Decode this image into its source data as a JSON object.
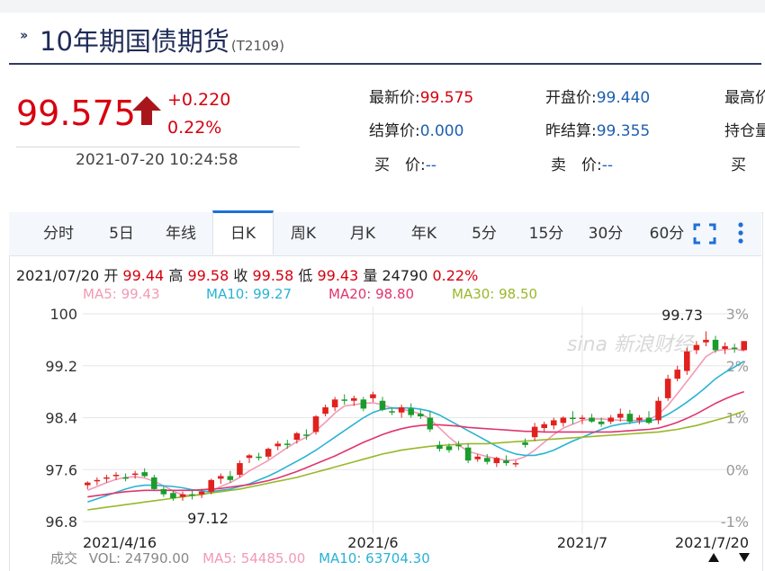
{
  "header": {
    "title": "10年期国债期货",
    "code": "(T2109)"
  },
  "quote": {
    "price": "99.575",
    "change": "+0.220",
    "change_pct": "0.22%",
    "datetime": "2021-07-20 10:24:58"
  },
  "fields": {
    "latest_label": "最新价:",
    "latest_value": "99.575",
    "open_label": "开盘价:",
    "open_value": "99.440",
    "high_label": "最高价",
    "settle_label": "结算价:",
    "settle_value": "0.000",
    "prev_settle_label": "昨结算:",
    "prev_settle_value": "99.355",
    "position_label": "持仓量",
    "buy_label": "买　价:",
    "buy_value": "--",
    "sell_label": "卖　价:",
    "sell_value": "--",
    "buy_vol_label": "买"
  },
  "tabs": [
    {
      "label": "分时"
    },
    {
      "label": "5日"
    },
    {
      "label": "年线"
    },
    {
      "label": "日K"
    },
    {
      "label": "周K"
    },
    {
      "label": "月K"
    },
    {
      "label": "年K"
    },
    {
      "label": "5分"
    },
    {
      "label": "15分"
    },
    {
      "label": "30分"
    },
    {
      "label": "60分"
    }
  ],
  "active_tab": "日K",
  "info": {
    "date": "2021/07/20",
    "open_label": "开",
    "open": "99.44",
    "high_label": "高",
    "high": "99.58",
    "close_label": "收",
    "close": "99.58",
    "low_label": "低",
    "low": "99.43",
    "vol_label": "量",
    "vol": "24790",
    "pct": "0.22%"
  },
  "ma": {
    "ma5": "MA5: 99.43",
    "ma10": "MA10: 99.27",
    "ma20": "MA20: 98.80",
    "ma30": "MA30: 98.50"
  },
  "volume": {
    "label": "成交",
    "vol": "VOL: 24790.00",
    "ma5": "MA5: 54485.00",
    "ma10": "MA10: 63704.30"
  },
  "colors": {
    "up": "#e0211d",
    "down": "#1a9c2c",
    "ma5": "#f29ab4",
    "ma10": "#2ab3d3",
    "ma20": "#e0356e",
    "ma30": "#98b82a",
    "accent": "#1d6fd8"
  },
  "chart_data": {
    "type": "candlestick",
    "y_ticks_left": [
      "100",
      "99.2",
      "98.4",
      "97.6",
      "96.8"
    ],
    "y_ticks_right": [
      "3%",
      "2%",
      "1%",
      "0%",
      "-1%"
    ],
    "ylim": [
      96.8,
      100
    ],
    "x_labels": [
      "2021/4/16",
      "2021/6",
      "2021/7",
      "2021/7/20"
    ],
    "annotations": {
      "max": "99.73",
      "min": "97.12"
    },
    "watermark": "新浪财经",
    "candles": [
      [
        97.36,
        97.42,
        97.3,
        97.4
      ],
      [
        97.42,
        97.48,
        97.36,
        97.44
      ],
      [
        97.46,
        97.52,
        97.4,
        97.48
      ],
      [
        97.5,
        97.56,
        97.44,
        97.52
      ],
      [
        97.48,
        97.54,
        97.42,
        97.46
      ],
      [
        97.52,
        97.58,
        97.46,
        97.54
      ],
      [
        97.56,
        97.62,
        97.48,
        97.5
      ],
      [
        97.48,
        97.52,
        97.28,
        97.3
      ],
      [
        97.3,
        97.34,
        97.18,
        97.22
      ],
      [
        97.24,
        97.28,
        97.12,
        97.16
      ],
      [
        97.18,
        97.26,
        97.12,
        97.22
      ],
      [
        97.22,
        97.28,
        97.14,
        97.2
      ],
      [
        97.22,
        97.3,
        97.16,
        97.26
      ],
      [
        97.26,
        97.46,
        97.22,
        97.44
      ],
      [
        97.46,
        97.54,
        97.38,
        97.5
      ],
      [
        97.5,
        97.58,
        97.4,
        97.44
      ],
      [
        97.52,
        97.74,
        97.48,
        97.7
      ],
      [
        97.78,
        97.84,
        97.7,
        97.82
      ],
      [
        97.8,
        97.86,
        97.74,
        97.78
      ],
      [
        97.8,
        97.94,
        97.76,
        97.92
      ],
      [
        97.96,
        98.04,
        97.9,
        98.0
      ],
      [
        98.0,
        98.06,
        97.92,
        97.98
      ],
      [
        98.06,
        98.18,
        98.0,
        98.16
      ],
      [
        98.14,
        98.22,
        98.06,
        98.12
      ],
      [
        98.18,
        98.44,
        98.14,
        98.42
      ],
      [
        98.46,
        98.6,
        98.42,
        98.56
      ],
      [
        98.56,
        98.72,
        98.5,
        98.68
      ],
      [
        98.68,
        98.76,
        98.6,
        98.66
      ],
      [
        98.66,
        98.74,
        98.58,
        98.7
      ],
      [
        98.68,
        98.72,
        98.5,
        98.54
      ],
      [
        98.7,
        98.8,
        98.64,
        98.76
      ],
      [
        98.66,
        98.72,
        98.5,
        98.52
      ],
      [
        98.5,
        98.56,
        98.44,
        98.48
      ],
      [
        98.48,
        98.6,
        98.4,
        98.56
      ],
      [
        98.54,
        98.62,
        98.4,
        98.44
      ],
      [
        98.46,
        98.52,
        98.38,
        98.42
      ],
      [
        98.4,
        98.5,
        98.18,
        98.22
      ],
      [
        97.98,
        98.04,
        97.88,
        97.92
      ],
      [
        97.96,
        98.0,
        97.86,
        97.9
      ],
      [
        97.98,
        98.04,
        97.9,
        97.96
      ],
      [
        97.94,
        98.0,
        97.7,
        97.74
      ],
      [
        97.76,
        97.84,
        97.72,
        97.8
      ],
      [
        97.78,
        97.84,
        97.68,
        97.72
      ],
      [
        97.7,
        97.8,
        97.64,
        97.78
      ],
      [
        97.74,
        97.82,
        97.66,
        97.7
      ],
      [
        97.68,
        97.74,
        97.64,
        97.7
      ],
      [
        98.02,
        98.08,
        97.94,
        97.98
      ],
      [
        98.1,
        98.32,
        98.04,
        98.26
      ],
      [
        98.24,
        98.34,
        98.18,
        98.3
      ],
      [
        98.28,
        98.4,
        98.22,
        98.36
      ],
      [
        98.32,
        98.42,
        98.26,
        98.4
      ],
      [
        98.4,
        98.5,
        98.3,
        98.38
      ],
      [
        98.38,
        98.44,
        98.3,
        98.4
      ],
      [
        98.4,
        98.46,
        98.32,
        98.34
      ],
      [
        98.34,
        98.4,
        98.26,
        98.3
      ],
      [
        98.34,
        98.44,
        98.3,
        98.4
      ],
      [
        98.4,
        98.54,
        98.34,
        98.46
      ],
      [
        98.46,
        98.52,
        98.3,
        98.34
      ],
      [
        98.36,
        98.44,
        98.3,
        98.4
      ],
      [
        98.4,
        98.5,
        98.3,
        98.32
      ],
      [
        98.36,
        98.72,
        98.3,
        98.66
      ],
      [
        98.7,
        99.06,
        98.66,
        99.0
      ],
      [
        99.0,
        99.2,
        98.96,
        99.14
      ],
      [
        99.12,
        99.48,
        99.06,
        99.42
      ],
      [
        99.44,
        99.58,
        99.38,
        99.52
      ],
      [
        99.56,
        99.73,
        99.5,
        99.6
      ],
      [
        99.6,
        99.66,
        99.4,
        99.44
      ],
      [
        99.46,
        99.56,
        99.38,
        99.5
      ],
      [
        99.48,
        99.54,
        99.4,
        99.46
      ],
      [
        99.44,
        99.58,
        99.43,
        99.58
      ]
    ],
    "ma_series": [
      {
        "name": "MA5",
        "start": 96.9,
        "values": [
          97.28,
          97.34,
          97.4,
          97.45,
          97.48,
          97.49,
          97.47,
          97.42,
          97.35,
          97.27,
          97.21,
          97.2,
          97.21,
          97.26,
          97.34,
          97.4,
          97.48,
          97.58,
          97.66,
          97.74,
          97.84,
          97.94,
          98.03,
          98.1,
          98.2,
          98.33,
          98.47,
          98.58,
          98.6,
          98.62,
          98.63,
          98.6,
          98.55,
          98.53,
          98.5,
          98.46,
          98.38,
          98.24,
          98.1,
          97.98,
          97.88,
          97.84,
          97.8,
          97.77,
          97.74,
          97.75,
          97.8,
          97.9,
          98.02,
          98.14,
          98.24,
          98.3,
          98.36,
          98.38,
          98.38,
          98.37,
          98.36,
          98.36,
          98.36,
          98.37,
          98.45,
          98.59,
          98.77,
          98.96,
          99.15,
          99.34,
          99.43,
          99.45,
          99.46,
          99.43
        ]
      },
      {
        "name": "MA10",
        "values": [
          97.1,
          97.15,
          97.2,
          97.25,
          97.3,
          97.34,
          97.36,
          97.36,
          97.35,
          97.34,
          97.32,
          97.29,
          97.27,
          97.26,
          97.28,
          97.3,
          97.34,
          97.38,
          97.44,
          97.5,
          97.57,
          97.65,
          97.73,
          97.81,
          97.9,
          98.0,
          98.1,
          98.2,
          98.3,
          98.4,
          98.48,
          98.53,
          98.55,
          98.55,
          98.55,
          98.53,
          98.5,
          98.44,
          98.36,
          98.28,
          98.2,
          98.12,
          98.04,
          97.96,
          97.89,
          97.84,
          97.82,
          97.82,
          97.85,
          97.9,
          97.97,
          98.04,
          98.1,
          98.16,
          98.22,
          98.27,
          98.3,
          98.32,
          98.34,
          98.35,
          98.38,
          98.45,
          98.54,
          98.64,
          98.75,
          98.87,
          99.0,
          99.1,
          99.18,
          99.27
        ]
      },
      {
        "name": "MA20",
        "values": [
          97.18,
          97.2,
          97.22,
          97.24,
          97.26,
          97.27,
          97.28,
          97.28,
          97.28,
          97.28,
          97.28,
          97.28,
          97.29,
          97.3,
          97.31,
          97.33,
          97.35,
          97.37,
          97.4,
          97.43,
          97.47,
          97.52,
          97.57,
          97.63,
          97.69,
          97.75,
          97.81,
          97.88,
          97.95,
          98.02,
          98.08,
          98.14,
          98.19,
          98.23,
          98.26,
          98.28,
          98.29,
          98.29,
          98.28,
          98.27,
          98.25,
          98.24,
          98.23,
          98.22,
          98.21,
          98.2,
          98.19,
          98.19,
          98.18,
          98.18,
          98.18,
          98.18,
          98.18,
          98.18,
          98.18,
          98.18,
          98.19,
          98.2,
          98.21,
          98.22,
          98.24,
          98.28,
          98.33,
          98.39,
          98.46,
          98.54,
          98.62,
          98.69,
          98.75,
          98.8
        ]
      },
      {
        "name": "MA30",
        "values": [
          96.98,
          97.0,
          97.02,
          97.04,
          97.06,
          97.08,
          97.1,
          97.12,
          97.14,
          97.16,
          97.18,
          97.2,
          97.22,
          97.24,
          97.26,
          97.28,
          97.3,
          97.33,
          97.36,
          97.39,
          97.42,
          97.45,
          97.48,
          97.52,
          97.56,
          97.6,
          97.64,
          97.68,
          97.72,
          97.76,
          97.8,
          97.84,
          97.87,
          97.9,
          97.92,
          97.94,
          97.96,
          97.97,
          97.98,
          97.99,
          98.0,
          98.0,
          98.0,
          98.01,
          98.02,
          98.03,
          98.04,
          98.05,
          98.06,
          98.07,
          98.08,
          98.09,
          98.1,
          98.11,
          98.12,
          98.13,
          98.14,
          98.15,
          98.16,
          98.17,
          98.18,
          98.2,
          98.22,
          98.25,
          98.28,
          98.32,
          98.36,
          98.4,
          98.45,
          98.5
        ]
      }
    ]
  }
}
